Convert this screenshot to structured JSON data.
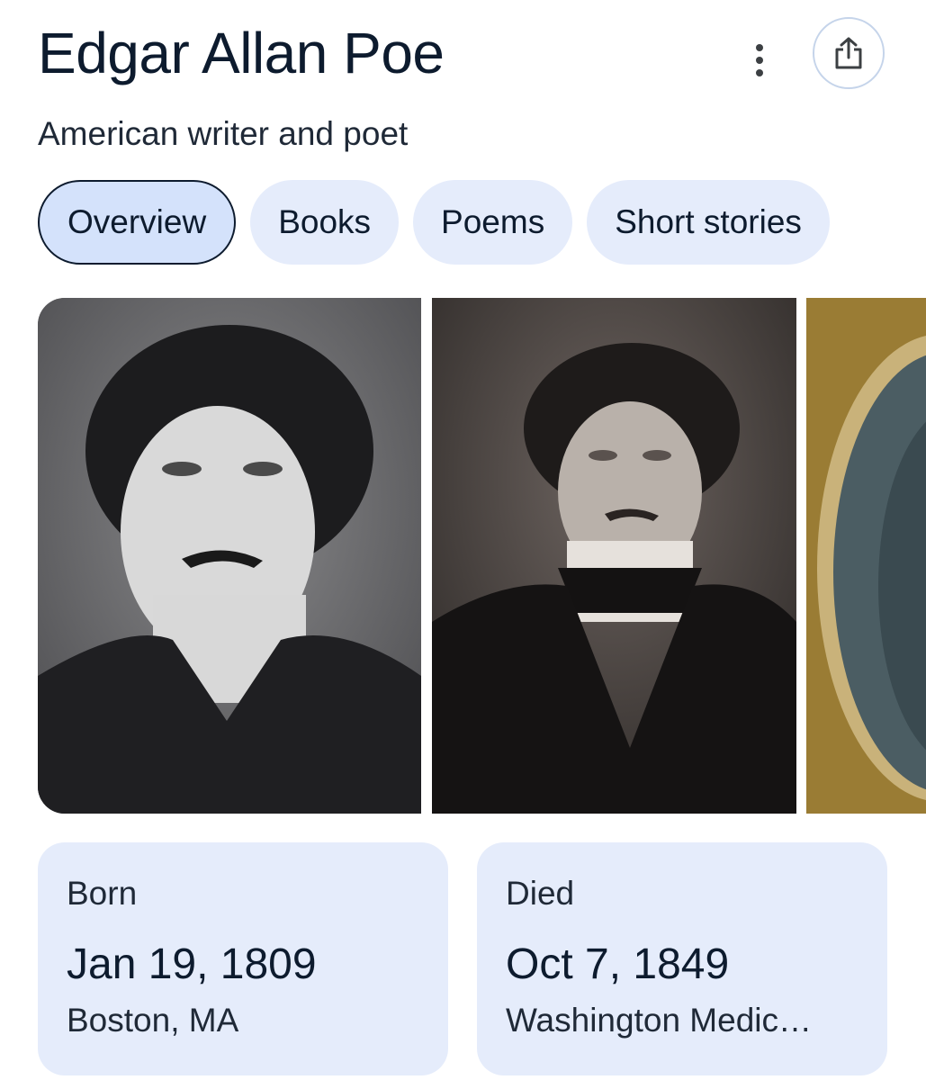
{
  "header": {
    "title": "Edgar Allan Poe",
    "subtitle": "American writer and poet"
  },
  "actions": {
    "more_icon": "more-vert-icon",
    "share_icon": "share-icon"
  },
  "tabs": [
    {
      "label": "Overview",
      "active": true
    },
    {
      "label": "Books",
      "active": false
    },
    {
      "label": "Poems",
      "active": false
    },
    {
      "label": "Short stories",
      "active": false
    }
  ],
  "images": [
    {
      "kind": "engraved portrait"
    },
    {
      "kind": "daguerreotype portrait"
    },
    {
      "kind": "framed miniature (partially visible)"
    }
  ],
  "facts": {
    "born": {
      "label": "Born",
      "date": "Jan 19, 1809",
      "place": "Boston, MA"
    },
    "died": {
      "label": "Died",
      "date": "Oct 7, 1849",
      "place": "Washington Medic…"
    }
  },
  "colors": {
    "chip_bg": "#e5ecfb",
    "chip_active_bg": "#d4e2fb",
    "text_dark": "#0d1b2e",
    "share_border": "#c5d4ea"
  }
}
